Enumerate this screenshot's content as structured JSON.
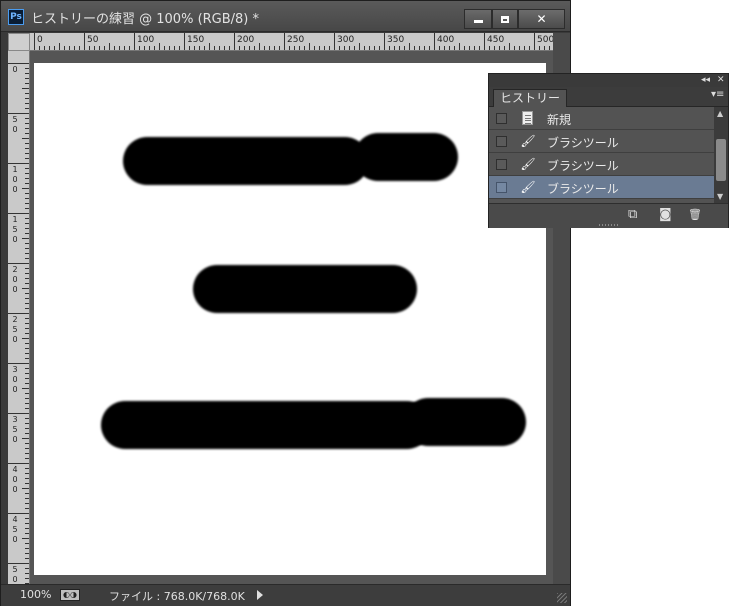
{
  "window": {
    "title": "ヒストリーの練習 @ 100% (RGB/8) *",
    "app_icon_text": "Ps",
    "close_glyph": "✕"
  },
  "rulers": {
    "top_labels": [
      "0",
      "50",
      "100",
      "150",
      "200",
      "250",
      "300",
      "350",
      "400",
      "450",
      "500"
    ],
    "left_labels": [
      "0",
      "50",
      "100",
      "150",
      "200",
      "250",
      "300",
      "350",
      "400",
      "450",
      "500"
    ]
  },
  "status": {
    "zoom": "100%",
    "file_info": "ファイル : 768.0K/768.0K"
  },
  "history_panel": {
    "tab_label": "ヒストリー",
    "collapse_glyph": "◂◂",
    "close_glyph": "✕",
    "menu_glyph": "▾≡",
    "items": [
      {
        "label": "新規",
        "icon": "document-icon",
        "selected": false
      },
      {
        "label": "ブラシツール",
        "icon": "brush-icon",
        "selected": false
      },
      {
        "label": "ブラシツール",
        "icon": "brush-icon",
        "selected": false
      },
      {
        "label": "ブラシツール",
        "icon": "brush-icon",
        "selected": true
      }
    ],
    "footer": {
      "new_document_glyph": "⧉",
      "snapshot_glyph": "◙",
      "delete_glyph": "🗑"
    }
  },
  "colors": {
    "chrome": "#3a3a3a",
    "panel": "#535353",
    "selected_row": "#6a7b93",
    "canvas": "#ffffff",
    "stroke": "#000000"
  }
}
